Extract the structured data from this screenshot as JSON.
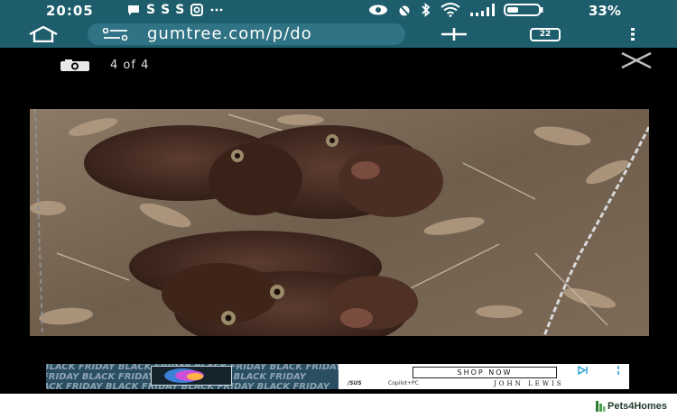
{
  "status_bar": {
    "time": "20:05",
    "notification_glyphs": [
      "S",
      "S",
      "S"
    ],
    "battery_percent": "33%"
  },
  "browser": {
    "url": "gumtree.com/p/do",
    "tab_count": "22",
    "icons": [
      "home-icon",
      "site-settings-icon",
      "new-tab-plus-icon",
      "tab-switcher-icon",
      "overflow-menu-icon"
    ]
  },
  "viewer": {
    "counter": "4 of 4",
    "icons": [
      "camera-icon",
      "close-icon"
    ]
  },
  "ad": {
    "banner_text": "BLACK FRIDAY BLACK FRIDAY BLACK FRIDAY BLACK FRIDAY",
    "button_label": "SHOP NOW",
    "brand_left": "/SUS",
    "product_text": "Copilot+PC",
    "brand_right": "JOHN LEWIS"
  },
  "footer": {
    "watermark": "Pets4Homes"
  },
  "colors": {
    "browser_bar": "#1d5d6c",
    "viewer_background": "#000000"
  }
}
